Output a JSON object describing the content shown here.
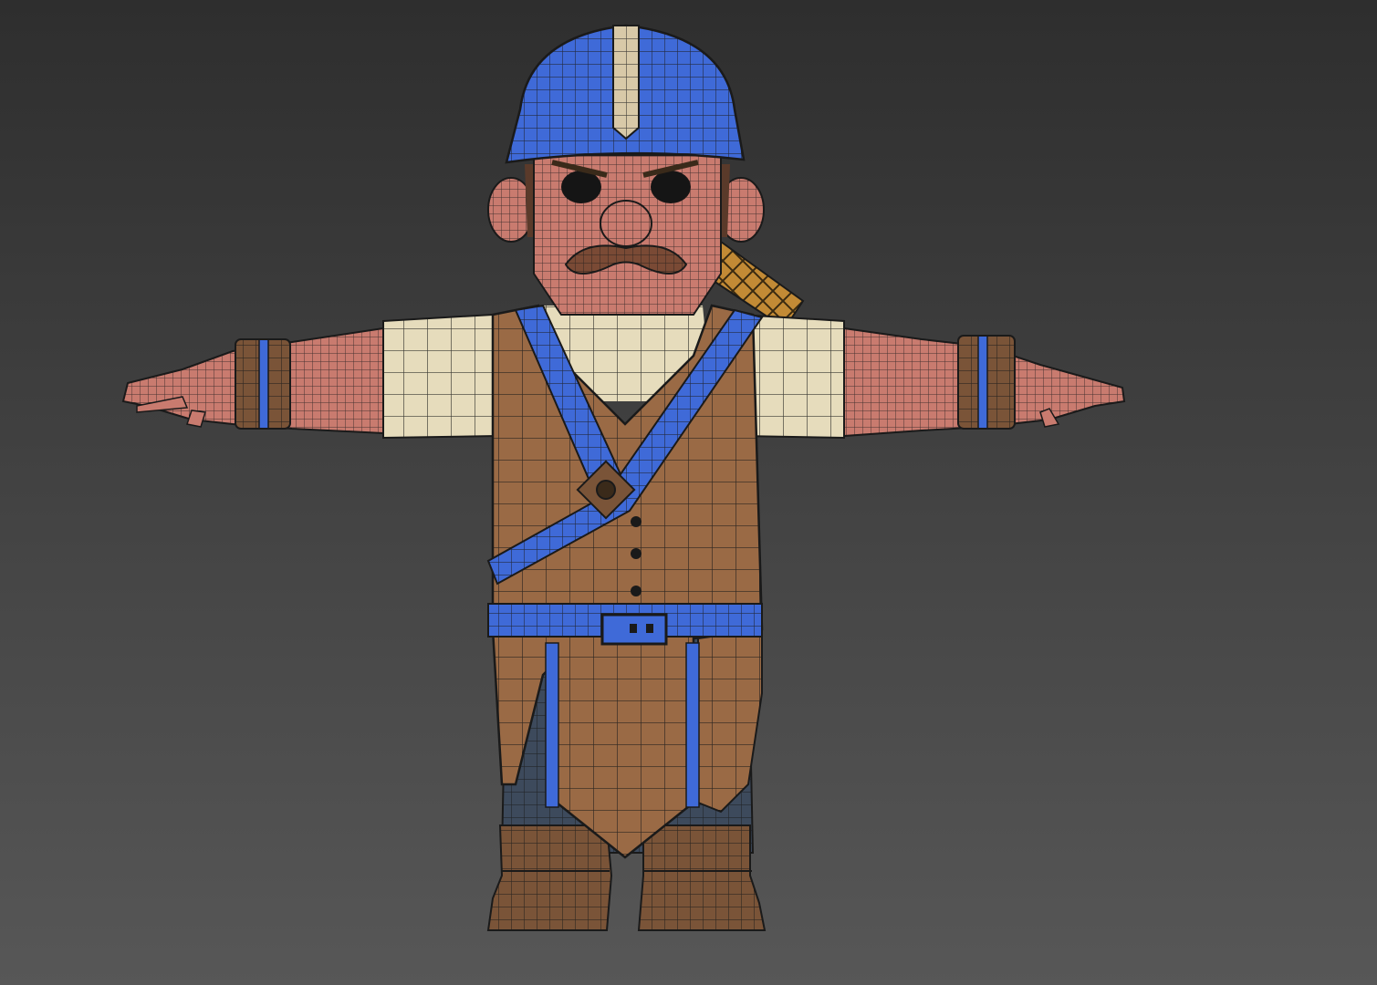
{
  "viewport": {
    "background_top": "#2f2f2f",
    "background_bottom": "#555555",
    "render_mode": "shaded-with-wireframe"
  },
  "model": {
    "subject": "cartoon-soldier-character",
    "pose": "T-pose",
    "colors": {
      "helmet": "#3f6ad8",
      "helmet_stripe": "#d8c9a8",
      "skin": "#c97b6f",
      "mustache": "#7a4a35",
      "shirt": "#e6dcbc",
      "vest": "#9a6a45",
      "strap": "#3f6ad8",
      "pants": "#3d4a5c",
      "boots": "#7a5438",
      "quiver": "#c28a35",
      "wire": "#1a1a1a"
    }
  }
}
